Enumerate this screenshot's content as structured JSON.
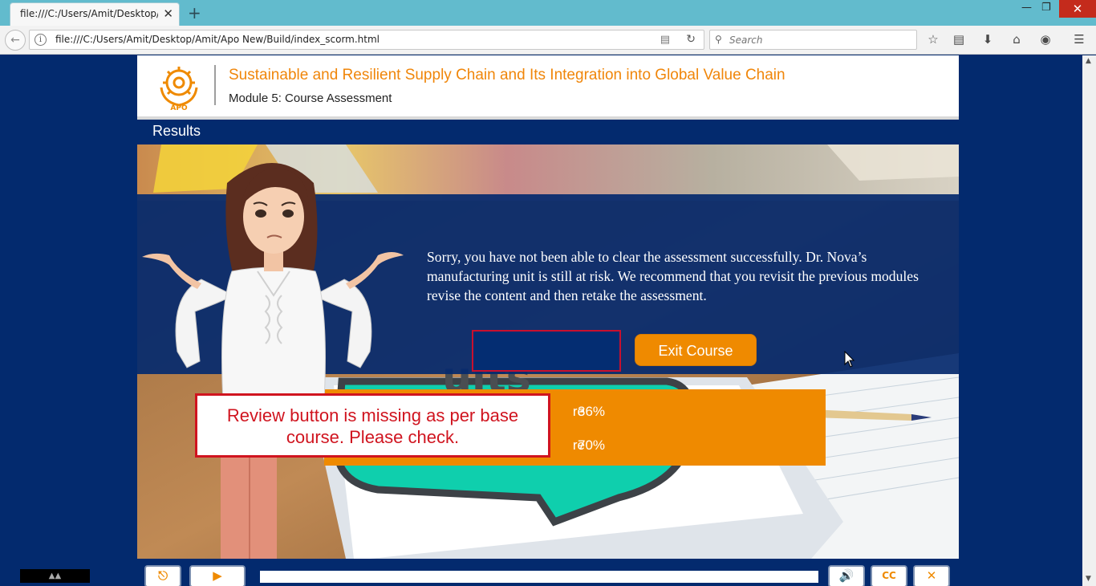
{
  "browser": {
    "tab_title": "file:///C:/Users/Amit/Desktop/A",
    "tab_close": "✕",
    "new_tab": "+",
    "url": "file:///C:/Users/Amit/Desktop/Amit/Apo New/Build/index_scorm.html",
    "search_placeholder": "Search",
    "icons": [
      "back-arrow-icon",
      "info-icon",
      "reader-view-icon",
      "reload-icon",
      "search-icon",
      "bookmark-star-icon",
      "reading-list-icon",
      "download-icon",
      "home-icon",
      "pocket-icon",
      "menu-icon"
    ]
  },
  "course": {
    "title": "Sustainable and Resilient Supply Chain and Its Integration into Global Value Chain",
    "module": "Module 5: Course Assessment",
    "section": "Results",
    "message": "Sorry, you have not been able to clear the assessment successfully. Dr. Nova’s manufacturing unit is still at risk. We recommend that you revisit the previous modules revise the content and then retake the assessment.",
    "exit_label": "Exit Course",
    "scores": [
      {
        "label": "re",
        "value": "36%"
      },
      {
        "label": "re",
        "value": "70%"
      }
    ],
    "callout": "Review button is missing as per base course. Please check."
  },
  "player": {
    "controls": [
      "exit-icon",
      "play-icon",
      "volume-icon",
      "cc-icon",
      "close-icon"
    ],
    "cc_label": "CC"
  },
  "colors": {
    "navy": "#032a6e",
    "orange": "#ef8a00",
    "callout_red": "#d0141f",
    "browser_tabbar": "#62bbcd"
  }
}
